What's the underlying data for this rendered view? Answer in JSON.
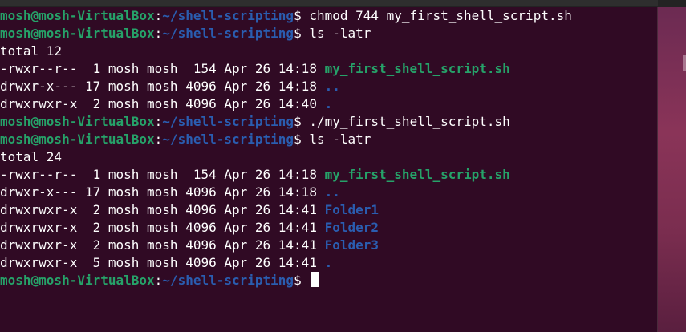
{
  "prompt": {
    "user_host": "mosh@mosh-VirtualBox",
    "colon": ":",
    "path": "~/shell-scripting",
    "dollar": "$"
  },
  "lines": [
    {
      "type": "prompt",
      "cmd": " chmod 744 my_first_shell_script.sh"
    },
    {
      "type": "prompt",
      "cmd": " ls -latr"
    },
    {
      "type": "text",
      "text": "total 12"
    },
    {
      "type": "entry",
      "meta": "-rwxr--r--  1 mosh mosh  154 Apr 26 14:18 ",
      "name": "my_first_shell_script.sh",
      "kind": "exec"
    },
    {
      "type": "entry",
      "meta": "drwxr-x--- 17 mosh mosh 4096 Apr 26 14:18 ",
      "name": "..",
      "kind": "dir"
    },
    {
      "type": "entry",
      "meta": "drwxrwxr-x  2 mosh mosh 4096 Apr 26 14:40 ",
      "name": ".",
      "kind": "dir"
    },
    {
      "type": "prompt",
      "cmd": " ./my_first_shell_script.sh"
    },
    {
      "type": "prompt",
      "cmd": " ls -latr"
    },
    {
      "type": "text",
      "text": "total 24"
    },
    {
      "type": "entry",
      "meta": "-rwxr--r--  1 mosh mosh  154 Apr 26 14:18 ",
      "name": "my_first_shell_script.sh",
      "kind": "exec"
    },
    {
      "type": "entry",
      "meta": "drwxr-x--- 17 mosh mosh 4096 Apr 26 14:18 ",
      "name": "..",
      "kind": "dir"
    },
    {
      "type": "entry",
      "meta": "drwxrwxr-x  2 mosh mosh 4096 Apr 26 14:41 ",
      "name": "Folder1",
      "kind": "dir"
    },
    {
      "type": "entry",
      "meta": "drwxrwxr-x  2 mosh mosh 4096 Apr 26 14:41 ",
      "name": "Folder2",
      "kind": "dir"
    },
    {
      "type": "entry",
      "meta": "drwxrwxr-x  2 mosh mosh 4096 Apr 26 14:41 ",
      "name": "Folder3",
      "kind": "dir"
    },
    {
      "type": "entry",
      "meta": "drwxrwxr-x  5 mosh mosh 4096 Apr 26 14:41 ",
      "name": ".",
      "kind": "dir"
    },
    {
      "type": "prompt",
      "cmd": " ",
      "cursor": true
    }
  ],
  "colors": {
    "background": "#300a24",
    "user_host": "#26a269",
    "path": "#2a5db0",
    "exec_file": "#26a269",
    "directory": "#2a5db0",
    "text": "#ffffff"
  }
}
